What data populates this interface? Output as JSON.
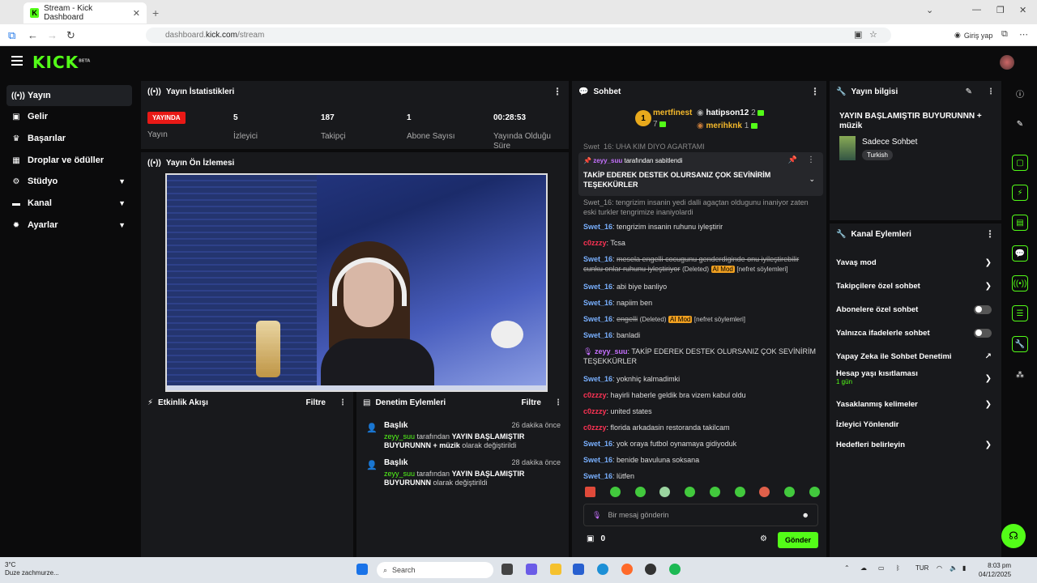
{
  "browser": {
    "tab_title": "Stream - Kick Dashboard",
    "url_prefix": "dashboard.",
    "url_domain": "kick.com",
    "url_path": "/stream",
    "profile_label": "Giriş yap"
  },
  "brand": {
    "logo": "KICK",
    "beta": "BETA",
    "accent": "#53fc18"
  },
  "sidebar": {
    "items": [
      {
        "label": "Yayın",
        "icon": "broadcast-icon"
      },
      {
        "label": "Gelir",
        "icon": "money-icon"
      },
      {
        "label": "Başarılar",
        "icon": "trophy-icon"
      },
      {
        "label": "Droplar ve ödüller",
        "icon": "gift-icon"
      },
      {
        "label": "Stüdyo",
        "icon": "studio-icon"
      },
      {
        "label": "Kanal",
        "icon": "channel-icon"
      },
      {
        "label": "Ayarlar",
        "icon": "gear-icon"
      }
    ]
  },
  "stats": {
    "title": "Yayın İstatistikleri",
    "live_badge": "YAYINDA",
    "live_label": "Yayın",
    "items": [
      {
        "value": "5",
        "label": "İzleyici"
      },
      {
        "value": "187",
        "label": "Takipçi"
      },
      {
        "value": "1",
        "label": "Abone Sayısı"
      },
      {
        "value": "00:28:53",
        "label": "Yayında Olduğu Süre"
      }
    ]
  },
  "preview": {
    "title": "Yayın Ön İzlemesi"
  },
  "activity": {
    "title": "Etkinlik Akışı",
    "filter": "Filtre"
  },
  "moderation": {
    "title": "Denetim Eylemleri",
    "filter": "Filtre",
    "rows": [
      {
        "title": "Başlık",
        "time": "26 dakika önce",
        "user": "zeyy_suu",
        "by": " tarafından ",
        "value": "YAYIN BAŞLAMIŞTIR BUYURUNNN + müzik",
        "suffix": " olarak değiştirildi"
      },
      {
        "title": "Başlık",
        "time": "28 dakika önce",
        "user": "zeyy_suu",
        "by": " tarafından ",
        "value": "YAYIN BAŞLAMIŞTIR BUYURUNNN",
        "suffix": " olarak değiştirildi"
      }
    ]
  },
  "chat": {
    "title": "Sohbet",
    "leaders": [
      {
        "name": "mertfinest",
        "count": "7",
        "rank": "1"
      },
      {
        "name": "hatipson12",
        "count": "2"
      },
      {
        "name": "merihknk",
        "count": "1"
      }
    ],
    "top_partial": "Swet_16: UHA KIM DIYO AGARTAMI",
    "pinned": {
      "user": "zeyy_suu",
      "by": "tarafından sabitlendi",
      "text": "TAKİP EDEREK DESTEK OLURSANIZ ÇOK SEVİNİRİM TEŞEKKÜRLER"
    },
    "under_pinned": "Swet_16: tengrizim insanin yedi dalli agaçtan oldugunu inaniyor zaten eski turkler tengrimize inaniyolardi",
    "messages": [
      {
        "user": "Swet_16",
        "text": "tengrizim insanin ruhunu iyleştirir",
        "c": "u1"
      },
      {
        "user": "c0zzzy",
        "text": "Tcsa",
        "c": "u2"
      },
      {
        "user": "Swet_16",
        "text": "mesela engelli cocugunu genderdiginde onu iyileştirebilir cunku onlar ruhunu iyleştiriyor",
        "c": "u1",
        "deleted": "(Deleted)",
        "mod": "AI Mod",
        "reason": "[nefret söylemleri]"
      },
      {
        "user": "Swet_16",
        "text": "abi biye banliyo",
        "c": "u1"
      },
      {
        "user": "Swet_16",
        "text": "napiim ben",
        "c": "u1"
      },
      {
        "user": "Swet_16",
        "text": "engelli",
        "c": "u1",
        "deleted": "(Deleted)",
        "mod": "AI Mod",
        "reason": "[nefret söylemleri]"
      },
      {
        "user": "Swet_16",
        "text": "banladi",
        "c": "u1"
      },
      {
        "user": "zeyy_suu",
        "text": "TAKİP EDEREK DESTEK OLURSANIZ ÇOK SEVİNİRİM TEŞEKKÜRLER",
        "c": "u3"
      },
      {
        "user": "Swet_16",
        "text": "yoknhiç kalmadimki",
        "c": "u1"
      },
      {
        "user": "c0zzzy",
        "text": "hayirli haberle geldik bra vizem kabul oldu",
        "c": "u2"
      },
      {
        "user": "c0zzzy",
        "text": "united states",
        "c": "u2"
      },
      {
        "user": "c0zzzy",
        "text": "florida arkadasin restoranda takilcam",
        "c": "u2"
      },
      {
        "user": "Swet_16",
        "text": "yok oraya futbol oynamaya gidiyoduk",
        "c": "u1"
      },
      {
        "user": "Swet_16",
        "text": "benide bavuluna soksana",
        "c": "u1"
      },
      {
        "user": "Swet_16",
        "text": "lütfen",
        "c": "u1"
      }
    ],
    "input_placeholder": "Bir mesaj gönderin",
    "points": "0",
    "send": "Gönder"
  },
  "info": {
    "title": "Yayın bilgisi",
    "stream_title": "YAYIN BAŞLAMIŞTIR BUYURUNNN + müzik",
    "category": "Sadece Sohbet",
    "language": "Turkish"
  },
  "channel_actions": {
    "title": "Kanal Eylemleri",
    "items": [
      {
        "label": "Yavaş mod",
        "ctrl": "arrow"
      },
      {
        "label": "Takipçilere özel sohbet",
        "ctrl": "arrow"
      },
      {
        "label": "Abonelere özel sohbet",
        "ctrl": "toggle"
      },
      {
        "label": "Yalnızca ifadelerle sohbet",
        "ctrl": "toggle"
      },
      {
        "label": "Yapay Zeka ile Sohbet Denetimi",
        "ctrl": "ext"
      },
      {
        "label": "Hesap yaşı kısıtlaması",
        "ctrl": "arrow",
        "sub": "1 gün"
      },
      {
        "label": "Yasaklanmış kelimeler",
        "ctrl": "arrow"
      },
      {
        "label": "İzleyici Yönlendir",
        "ctrl": "none"
      },
      {
        "label": "Hedefleri belirleyin",
        "ctrl": "arrow"
      }
    ]
  },
  "taskbar": {
    "temp": "3°C",
    "weather": "Duze zachmurze...",
    "search": "Search",
    "lang": "TUR",
    "time": "8:03 pm",
    "date": "04/12/2025"
  }
}
